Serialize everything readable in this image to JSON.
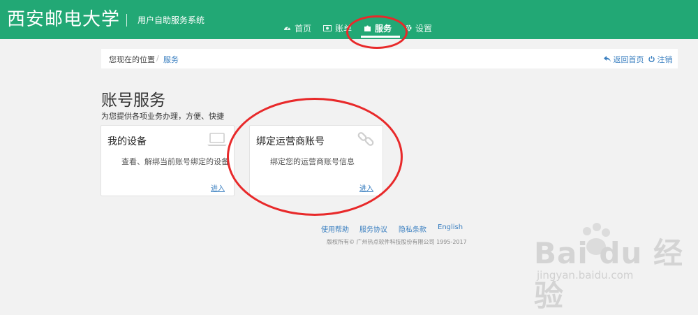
{
  "header": {
    "brand": "西安邮电大学",
    "subtitle": "用户自助服务系统",
    "nav": [
      {
        "label": "首页",
        "icon": "dashboard-icon"
      },
      {
        "label": "账单",
        "icon": "money-icon"
      },
      {
        "label": "服务",
        "icon": "puzzle-icon",
        "active": true
      },
      {
        "label": "设置",
        "icon": "gear-icon"
      }
    ]
  },
  "breadcrumb": {
    "location_label": "您现在的位置",
    "separator": "/",
    "current": "服务",
    "back_home": "返回首页",
    "logout": "注销"
  },
  "page": {
    "title": "账号服务",
    "description": "为您提供各项业务办理，方便、快捷"
  },
  "cards": [
    {
      "title": "我的设备",
      "description": "查看、解绑当前账号绑定的设备",
      "enter": "进入",
      "icon": "laptop-icon"
    },
    {
      "title": "绑定运营商账号",
      "description": "绑定您的运营商账号信息",
      "enter": "进入",
      "icon": "link-icon"
    }
  ],
  "footer": {
    "links": [
      "使用帮助",
      "服务协议",
      "隐私条款",
      "English"
    ],
    "copyright": "版权所有© 广州热点软件科技股份有限公司 1995-2017"
  },
  "watermark": {
    "main": "Bai du 经验",
    "url": "jingyan.baidu.com"
  },
  "colors": {
    "header_bg": "#22a875",
    "link": "#3a7fc0",
    "annotation": "#e8292a"
  }
}
